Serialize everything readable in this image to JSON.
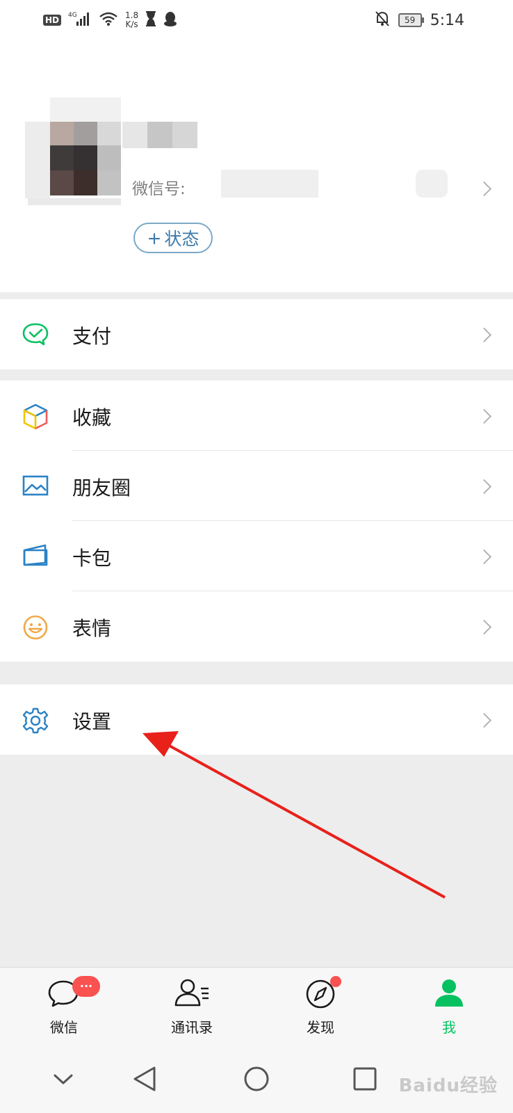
{
  "status_bar": {
    "hd": "HD",
    "network": "4G",
    "speed_value": "1.8",
    "speed_unit": "K/s",
    "battery": "59",
    "time": "5:14"
  },
  "profile": {
    "wechat_id_label": "微信号:",
    "status_button_plus": "+",
    "status_button_label": "状态"
  },
  "menu": {
    "pay": "支付",
    "favorites": "收藏",
    "moments": "朋友圈",
    "cards": "卡包",
    "stickers": "表情",
    "settings": "设置"
  },
  "tabbar": {
    "chats": "微信",
    "chats_badge": "···",
    "contacts": "通讯录",
    "discover": "发现",
    "me": "我"
  },
  "watermark": "Baidu经验",
  "colors": {
    "accent_green": "#07c160",
    "badge_red": "#fa5151",
    "arrow_red": "#e8211b",
    "icon_blue": "#2b82c5"
  }
}
